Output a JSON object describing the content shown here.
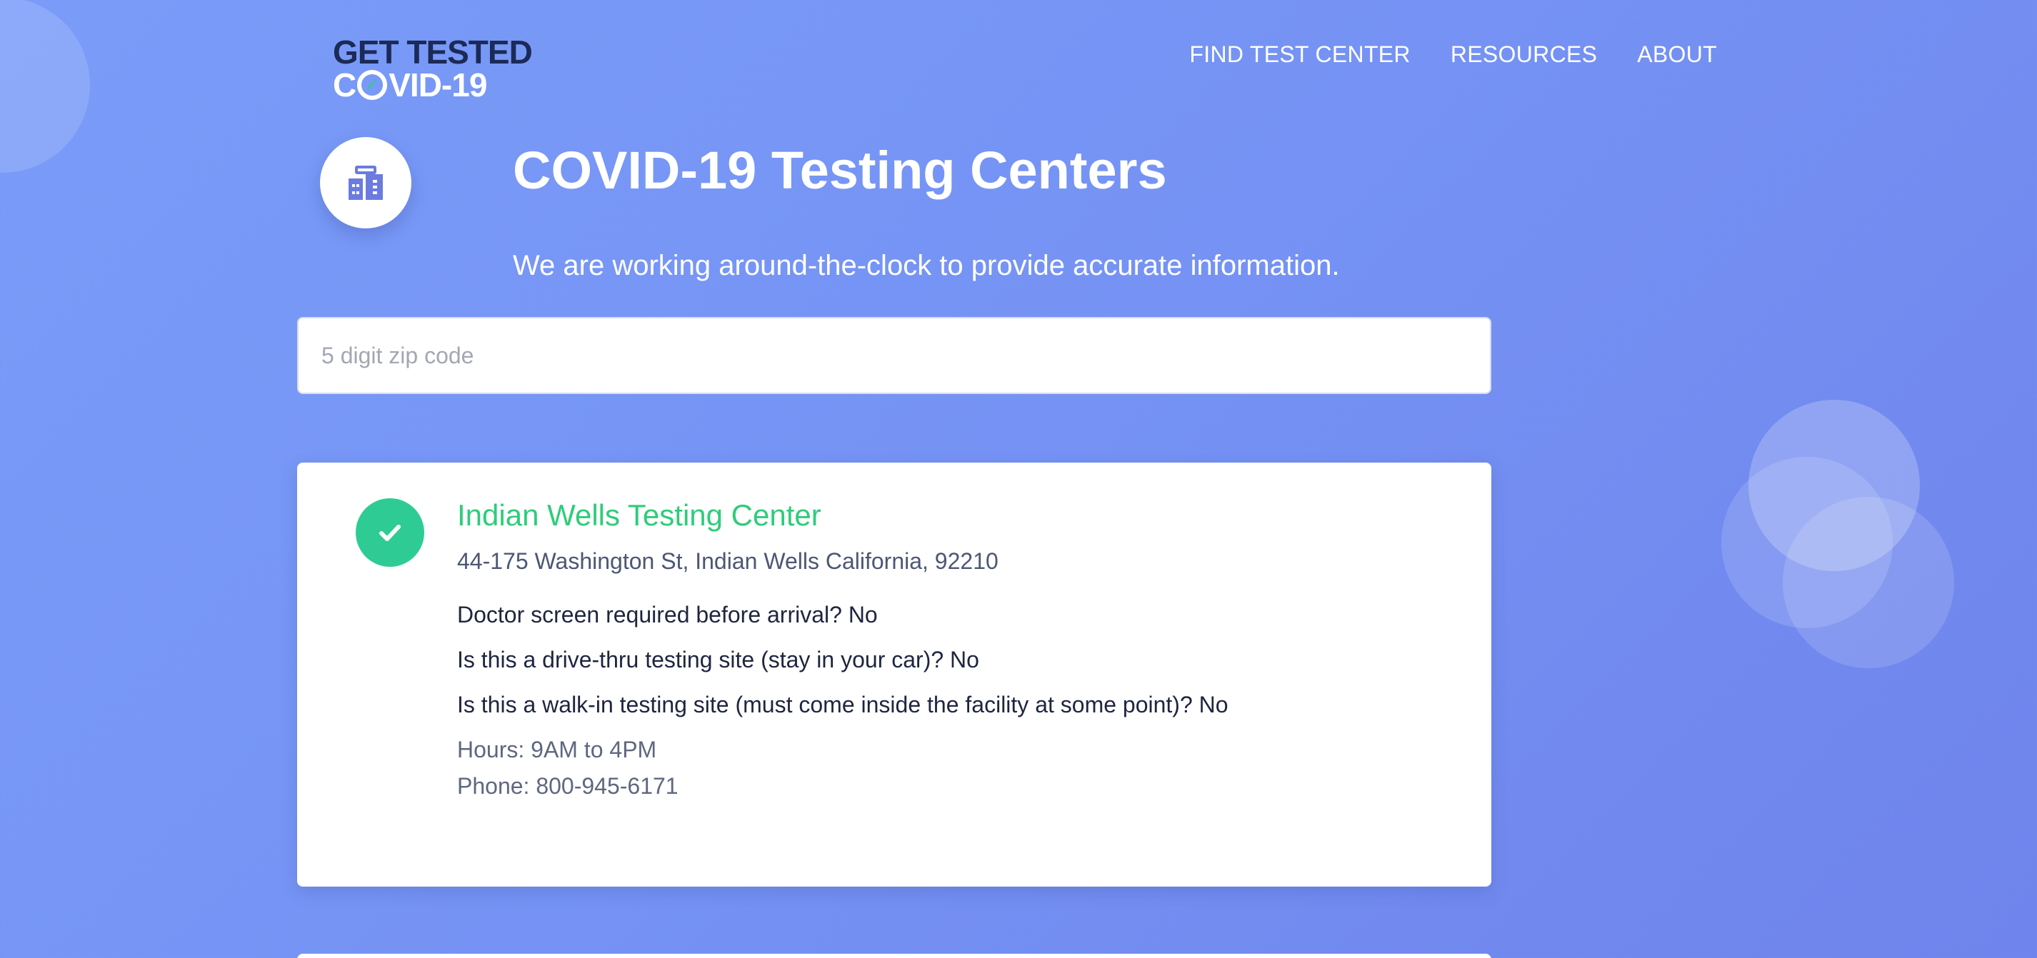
{
  "logo": {
    "line1": "GET TESTED",
    "line2_left": "C",
    "line2_right": "VID-19"
  },
  "nav": {
    "items": [
      {
        "label": "FIND TEST CENTER"
      },
      {
        "label": "RESOURCES"
      },
      {
        "label": "ABOUT"
      }
    ]
  },
  "hero": {
    "icon": "building-icon",
    "title": "COVID-19 Testing Centers",
    "subtitle": "We are working around-the-clock to provide accurate information."
  },
  "search": {
    "placeholder": "5 digit zip code",
    "value": ""
  },
  "results": [
    {
      "status_icon": "check-icon",
      "name": "Indian Wells Testing Center",
      "address": "44-175 Washington St, Indian Wells California, 92210",
      "doctor_screen": "Doctor screen required before arrival? No",
      "drive_thru": "Is this a drive-thru testing site (stay in your car)? No",
      "walk_in": "Is this a walk-in testing site (must come inside the facility at some point)? No",
      "hours": "Hours: 9AM to 4PM",
      "phone": "Phone: 800-945-6171"
    }
  ],
  "colors": {
    "background": "#7592f4",
    "accent_green": "#2ecc94",
    "logo_navy": "#1b2a57",
    "icon_indigo": "#6b7be0"
  }
}
